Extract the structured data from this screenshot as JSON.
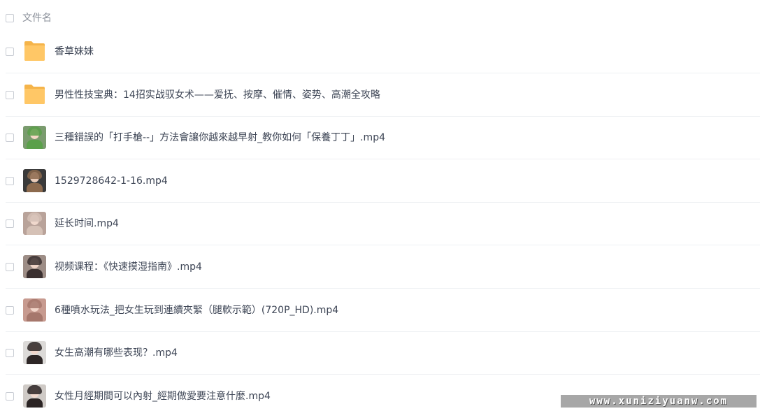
{
  "header": {
    "label": "文件名"
  },
  "files": [
    {
      "name": "香草妹妹",
      "kind": "folder",
      "icon": "folder-icon"
    },
    {
      "name": "男性性技宝典：14招实战驭女术——爱抚、按摩、催情、姿势、高潮全攻略",
      "kind": "folder",
      "icon": "folder-icon"
    },
    {
      "name": "三種錯誤的「打手槍--」方法會讓你越來越早射_教你如何「保養丁丁」.mp4",
      "kind": "video",
      "icon": "video-thumbnail"
    },
    {
      "name": "1529728642-1-16.mp4",
      "kind": "video",
      "icon": "video-thumbnail"
    },
    {
      "name": "延长时间.mp4",
      "kind": "video",
      "icon": "video-thumbnail"
    },
    {
      "name": "视频课程：《快速摸湿指南》.mp4",
      "kind": "video",
      "icon": "video-thumbnail"
    },
    {
      "name": "6種噴水玩法_把女生玩到連續夾緊（腿軟示範）(720P_HD).mp4",
      "kind": "video",
      "icon": "video-thumbnail"
    },
    {
      "name": "女生高潮有哪些表现？.mp4",
      "kind": "video",
      "icon": "video-thumbnail"
    },
    {
      "name": "女性月經期間可以內射_經期做愛要注意什麼.mp4",
      "kind": "video",
      "icon": "video-thumbnail"
    }
  ],
  "watermark": "www.xuniziyuanw.com",
  "colors": {
    "folder": "#ffc766",
    "folder_dark": "#f5b44a",
    "divider": "#eef0f3",
    "text": "#3e4656",
    "header_text": "#8a8f99"
  }
}
